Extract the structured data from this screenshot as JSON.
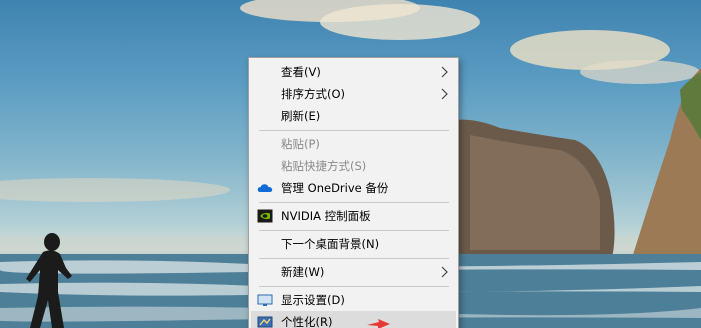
{
  "menu": {
    "items": [
      {
        "label": "查看(V)"
      },
      {
        "label": "排序方式(O)"
      },
      {
        "label": "刷新(E)"
      },
      {
        "label": "粘贴(P)"
      },
      {
        "label": "粘贴快捷方式(S)"
      },
      {
        "label": "管理 OneDrive 备份"
      },
      {
        "label": "NVIDIA 控制面板"
      },
      {
        "label": "下一个桌面背景(N)"
      },
      {
        "label": "新建(W)"
      },
      {
        "label": "显示设置(D)"
      },
      {
        "label": "个性化(R)"
      }
    ]
  },
  "icons": {
    "submenu": "chevron-right-icon",
    "onedrive": "onedrive-cloud-icon",
    "nvidia": "nvidia-logo-icon",
    "display": "display-settings-icon",
    "personalize": "personalize-icon"
  },
  "colors": {
    "menu_bg": "#f2f2f2",
    "menu_hover": "#dcdcdc",
    "disabled_text": "#8a8a8a",
    "onedrive_blue": "#0f6cd6",
    "nvidia_green": "#76b900",
    "pointer_red": "#e53935"
  }
}
